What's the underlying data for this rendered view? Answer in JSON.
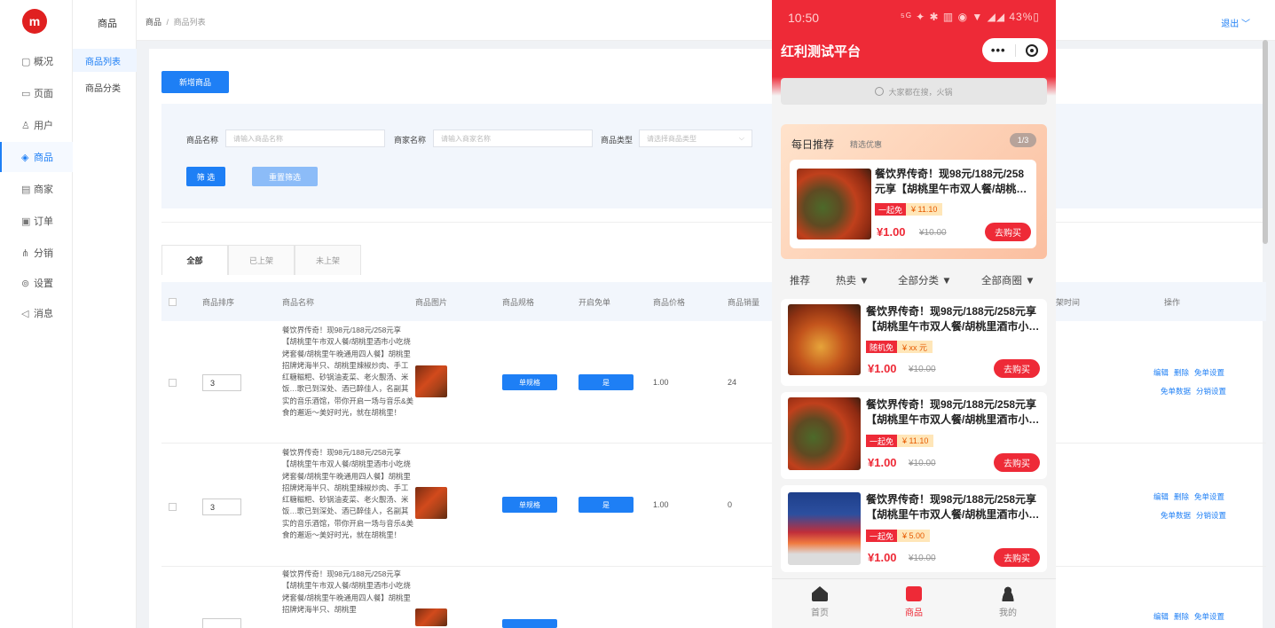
{
  "brand": {
    "logo_text": "m",
    "accent": "#1e7ff5",
    "phone_accent": "#ee2a37"
  },
  "sidebar": {
    "items": [
      {
        "icon": "dashboard-icon",
        "label": "概况"
      },
      {
        "icon": "page-icon",
        "label": "页面"
      },
      {
        "icon": "user-icon",
        "label": "用户"
      },
      {
        "icon": "product-icon",
        "label": "商品"
      },
      {
        "icon": "store-icon",
        "label": "商家"
      },
      {
        "icon": "order-icon",
        "label": "订单"
      },
      {
        "icon": "distribution-icon",
        "label": "分销"
      },
      {
        "icon": "settings-icon",
        "label": "设置"
      },
      {
        "icon": "message-icon",
        "label": "消息"
      }
    ]
  },
  "subnav": {
    "title": "商品",
    "items": [
      "商品列表",
      "商品分类"
    ]
  },
  "topbar": {
    "crumb_root": "商品",
    "crumb_sep": "/",
    "crumb_current": "商品列表",
    "logout": "退出 ﹀"
  },
  "toolbar": {
    "new_label": "新增商品"
  },
  "filters": {
    "name_label": "商品名称",
    "name_placeholder": "请输入商品名称",
    "merchant_label": "商家名称",
    "merchant_placeholder": "请输入商家名称",
    "type_label": "商品类型",
    "type_placeholder": "请选择商品类型",
    "filter_btn": "筛 选",
    "reset_btn": "重置筛选"
  },
  "tabs": [
    "全部",
    "已上架",
    "未上架"
  ],
  "table": {
    "headers": [
      "商品排序",
      "商品名称",
      "商品图片",
      "商品规格",
      "开启免单",
      "商品价格",
      "商品销量",
      "架时间",
      "操作"
    ],
    "rows": [
      {
        "sort": "3",
        "desc": "餐饮界传奇！现98元/188元/258元享【胡桃里午市双人餐/胡桃里酒市小吃烧烤套餐/胡桃里午晚通用四人餐】胡桃里招牌烤海半只、胡桃里辣椒炒肉、手工红糖糍粑、砂锅油麦菜、老火靓汤、米饭…歌已到深处、酒已醉佳人，名副其实的音乐酒馆，带你开启一场与音乐&美食的邂逅～美好时光，就在胡桃里！",
        "spec": "单规格",
        "free": "是",
        "price": "1.00",
        "sales": "24",
        "ops1": [
          "编辑",
          "删除",
          "免单设置"
        ],
        "ops2": [
          "免单数据",
          "分销设置"
        ]
      },
      {
        "sort": "3",
        "desc": "餐饮界传奇！现98元/188元/258元享【胡桃里午市双人餐/胡桃里酒市小吃烧烤套餐/胡桃里午晚通用四人餐】胡桃里招牌烤海半只、胡桃里辣椒炒肉、手工红糖糍粑、砂锅油麦菜、老火靓汤、米饭…歌已到深处、酒已醉佳人，名副其实的音乐酒馆，带你开启一场与音乐&美食的邂逅～美好时光，就在胡桃里！",
        "spec": "单规格",
        "free": "是",
        "price": "1.00",
        "sales": "0",
        "ops1": [
          "编辑",
          "删除",
          "免单设置"
        ],
        "ops2": [
          "免单数据",
          "分销设置"
        ]
      },
      {
        "sort": "",
        "desc": "餐饮界传奇！现98元/188元/258元享【胡桃里午市双人餐/胡桃里酒市小吃烧烤套餐/胡桃里午晚通用四人餐】胡桃里招牌烤海半只、胡桃里",
        "spec": "",
        "free": "",
        "price": "",
        "sales": "",
        "ops1": [
          "编辑",
          "删除",
          "免单设置"
        ],
        "ops2": []
      }
    ]
  },
  "phone": {
    "time": "10:50",
    "status_right": "⁵ᴳ ✦ ✱ ▥ ◉ ▼ ◢◢ 43%▯",
    "title": "红利测试平台",
    "search_placeholder": "大家都在搜，火锅",
    "daily": {
      "title": "每日推荐",
      "subtitle": "精选优惠",
      "page": "1/3",
      "item": {
        "title": "餐饮界传奇！现98元/188元/258元享【胡桃里午市双人餐/胡桃…",
        "badge1": "一起免",
        "badge2": "¥ 11.10",
        "price": "¥1.00",
        "orig": "¥10.00",
        "buy": "去购买"
      }
    },
    "sort": [
      "推荐",
      "热卖 ▼",
      "全部分类 ▼",
      "全部商圈 ▼"
    ],
    "products": [
      {
        "title": "餐饮界传奇！现98元/188元/258元享【胡桃里午市双人餐/胡桃里酒市小…",
        "badge1": "随机免",
        "badge2": "¥ xx 元",
        "price": "¥1.00",
        "orig": "¥10.00",
        "buy": "去购买",
        "img": "dish"
      },
      {
        "title": "餐饮界传奇！现98元/188元/258元享【胡桃里午市双人餐/胡桃里酒市小…",
        "badge1": "一起免",
        "badge2": "¥ 11.10",
        "price": "¥1.00",
        "orig": "¥10.00",
        "buy": "去购买",
        "img": "crawfish"
      },
      {
        "title": "餐饮界传奇！现98元/188元/258元享【胡桃里午市双人餐/胡桃里酒市小…",
        "badge1": "一起免",
        "badge2": "¥ 5.00",
        "price": "¥1.00",
        "orig": "¥10.00",
        "buy": "去购买",
        "img": "store"
      }
    ],
    "tabbar": [
      "首页",
      "商品",
      "我的"
    ]
  }
}
